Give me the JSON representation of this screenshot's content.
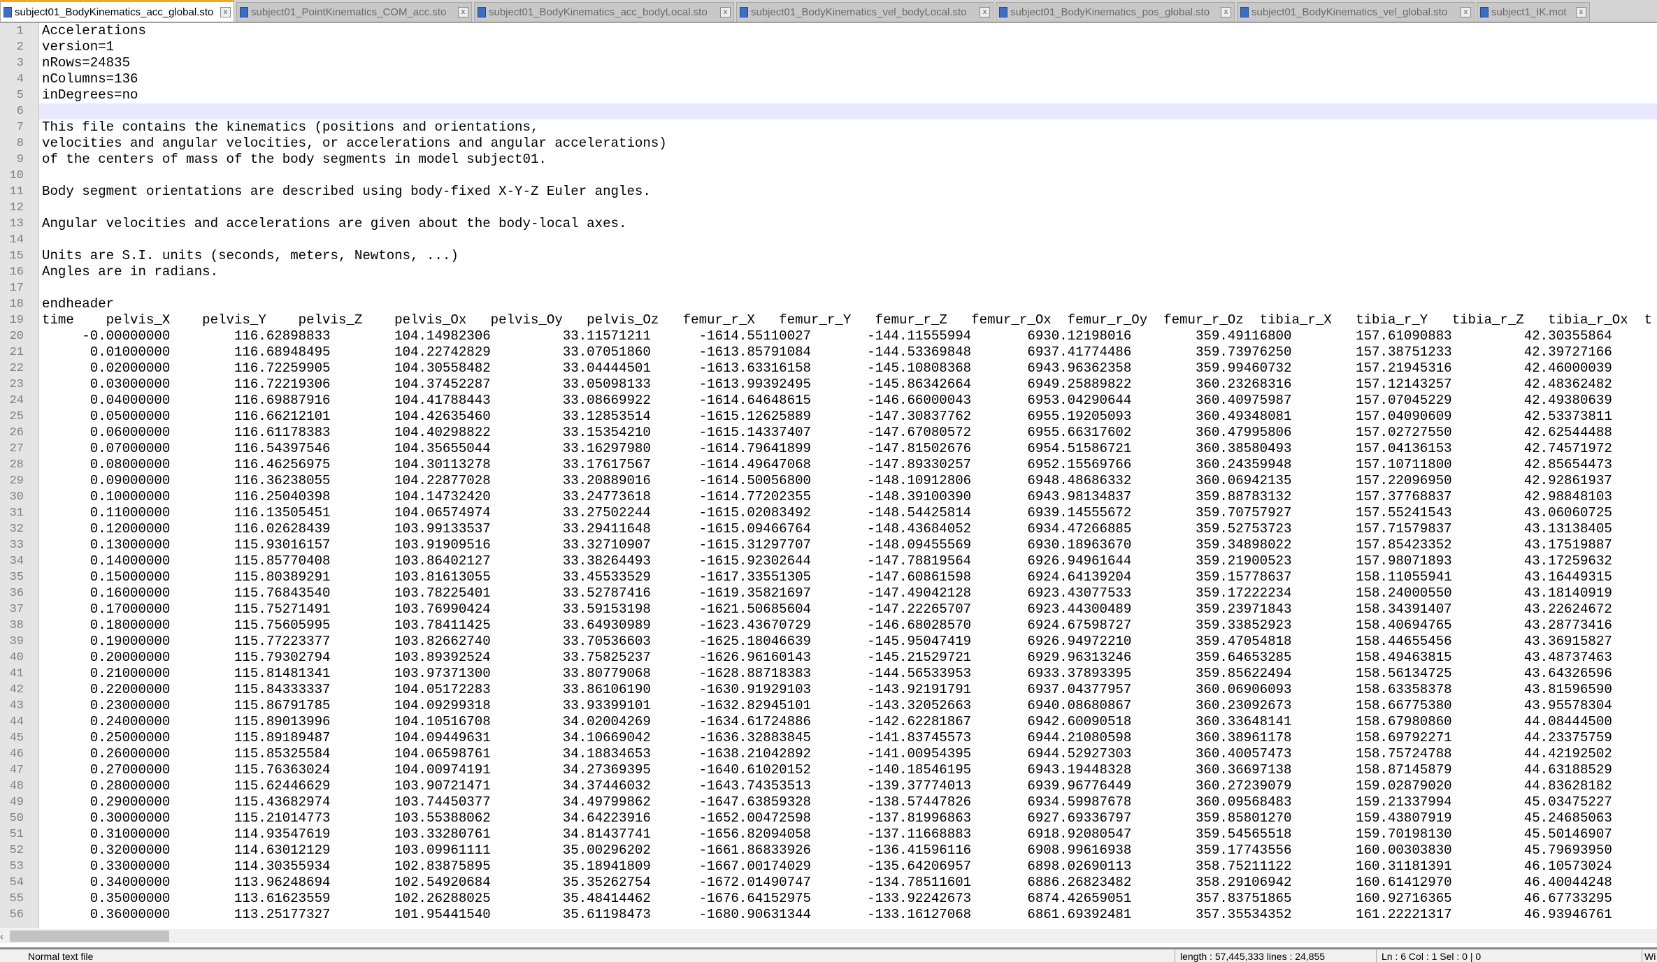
{
  "tabs": [
    {
      "label": "subject01_BodyKinematics_acc_global.sto",
      "active": true
    },
    {
      "label": "subject01_PointKinematics_COM_acc.sto",
      "active": false
    },
    {
      "label": "subject01_BodyKinematics_acc_bodyLocal.sto",
      "active": false
    },
    {
      "label": "subject01_BodyKinematics_vel_bodyLocal.sto",
      "active": false
    },
    {
      "label": "subject01_BodyKinematics_pos_global.sto",
      "active": false
    },
    {
      "label": "subject01_BodyKinematics_vel_global.sto",
      "active": false
    },
    {
      "label": "subject1_IK.mot",
      "active": false
    }
  ],
  "header_lines": [
    "Accelerations",
    "version=1",
    "nRows=24835",
    "nColumns=136",
    "inDegrees=no",
    "",
    "This file contains the kinematics (positions and orientations,",
    "velocities and angular velocities, or accelerations and angular accelerations)",
    "of the centers of mass of the body segments in model subject01.",
    "",
    "Body segment orientations are described using body-fixed X-Y-Z Euler angles.",
    "",
    "Angular velocities and accelerations are given about the body-local axes.",
    "",
    "Units are S.I. units (seconds, meters, Newtons, ...)",
    "Angles are in radians.",
    "",
    "endheader"
  ],
  "current_line": 6,
  "columns": [
    "time",
    "pelvis_X",
    "pelvis_Y",
    "pelvis_Z",
    "pelvis_Ox",
    "pelvis_Oy",
    "pelvis_Oz",
    "femur_r_X",
    "femur_r_Y",
    "femur_r_Z",
    "femur_r_Ox",
    "femur_r_Oy",
    "femur_r_Oz",
    "tibia_r_X",
    "tibia_r_Y",
    "tibia_r_Z",
    "tibia_r_Ox",
    "t"
  ],
  "rows": [
    [
      "-0.00000000",
      "116.62898833",
      "104.14982306",
      "33.11571211",
      "-1614.55110027",
      "-144.11555994",
      "6930.12198016",
      "359.49116800",
      "157.61090883",
      "42.30355864"
    ],
    [
      "0.01000000",
      "116.68948495",
      "104.22742829",
      "33.07051860",
      "-1613.85791084",
      "-144.53369848",
      "6937.41774486",
      "359.73976250",
      "157.38751233",
      "42.39727166"
    ],
    [
      "0.02000000",
      "116.72259905",
      "104.30558482",
      "33.04444501",
      "-1613.63316158",
      "-145.10808368",
      "6943.96362358",
      "359.99460732",
      "157.21945316",
      "42.46000039"
    ],
    [
      "0.03000000",
      "116.72219306",
      "104.37452287",
      "33.05098133",
      "-1613.99392495",
      "-145.86342664",
      "6949.25889822",
      "360.23268316",
      "157.12143257",
      "42.48362482"
    ],
    [
      "0.04000000",
      "116.69887916",
      "104.41788443",
      "33.08669922",
      "-1614.64648615",
      "-146.66000043",
      "6953.04290644",
      "360.40975987",
      "157.07045229",
      "42.49380639"
    ],
    [
      "0.05000000",
      "116.66212101",
      "104.42635460",
      "33.12853514",
      "-1615.12625889",
      "-147.30837762",
      "6955.19205093",
      "360.49348081",
      "157.04090609",
      "42.53373811"
    ],
    [
      "0.06000000",
      "116.61178383",
      "104.40298822",
      "33.15354210",
      "-1615.14337407",
      "-147.67080572",
      "6955.66317602",
      "360.47995806",
      "157.02727550",
      "42.62544488"
    ],
    [
      "0.07000000",
      "116.54397546",
      "104.35655044",
      "33.16297980",
      "-1614.79641899",
      "-147.81502676",
      "6954.51586721",
      "360.38580493",
      "157.04136153",
      "42.74571972"
    ],
    [
      "0.08000000",
      "116.46256975",
      "104.30113278",
      "33.17617567",
      "-1614.49647068",
      "-147.89330257",
      "6952.15569766",
      "360.24359948",
      "157.10711800",
      "42.85654473"
    ],
    [
      "0.09000000",
      "116.36238055",
      "104.22877028",
      "33.20889016",
      "-1614.50056800",
      "-148.10912806",
      "6948.48686332",
      "360.06942135",
      "157.22096950",
      "42.92861937"
    ],
    [
      "0.10000000",
      "116.25040398",
      "104.14732420",
      "33.24773618",
      "-1614.77202355",
      "-148.39100390",
      "6943.98134837",
      "359.88783132",
      "157.37768837",
      "42.98848103"
    ],
    [
      "0.11000000",
      "116.13505451",
      "104.06574974",
      "33.27502244",
      "-1615.02083492",
      "-148.54425814",
      "6939.14555672",
      "359.70757927",
      "157.55241543",
      "43.06060725"
    ],
    [
      "0.12000000",
      "116.02628439",
      "103.99133537",
      "33.29411648",
      "-1615.09466764",
      "-148.43684052",
      "6934.47266885",
      "359.52753723",
      "157.71579837",
      "43.13138405"
    ],
    [
      "0.13000000",
      "115.93016157",
      "103.91909516",
      "33.32710907",
      "-1615.31297707",
      "-148.09455569",
      "6930.18963670",
      "359.34898022",
      "157.85423352",
      "43.17519887"
    ],
    [
      "0.14000000",
      "115.85770408",
      "103.86402127",
      "33.38264493",
      "-1615.92302644",
      "-147.78819564",
      "6926.94961644",
      "359.21900523",
      "157.98071893",
      "43.17259632"
    ],
    [
      "0.15000000",
      "115.80389291",
      "103.81613055",
      "33.45533529",
      "-1617.33551305",
      "-147.60861598",
      "6924.64139204",
      "359.15778637",
      "158.11055941",
      "43.16449315"
    ],
    [
      "0.16000000",
      "115.76843540",
      "103.78225401",
      "33.52787416",
      "-1619.35821697",
      "-147.49042128",
      "6923.43077533",
      "359.17222234",
      "158.24000550",
      "43.18140919"
    ],
    [
      "0.17000000",
      "115.75271491",
      "103.76990424",
      "33.59153198",
      "-1621.50685604",
      "-147.22265707",
      "6923.44300489",
      "359.23971843",
      "158.34391407",
      "43.22624672"
    ],
    [
      "0.18000000",
      "115.75605995",
      "103.78411425",
      "33.64930989",
      "-1623.43670729",
      "-146.68028570",
      "6924.67598727",
      "359.33852923",
      "158.40694765",
      "43.28773416"
    ],
    [
      "0.19000000",
      "115.77223377",
      "103.82662740",
      "33.70536603",
      "-1625.18046639",
      "-145.95047419",
      "6926.94972210",
      "359.47054818",
      "158.44655456",
      "43.36915827"
    ],
    [
      "0.20000000",
      "115.79302794",
      "103.89392524",
      "33.75825237",
      "-1626.96160143",
      "-145.21529721",
      "6929.96313246",
      "359.64653285",
      "158.49463815",
      "43.48737463"
    ],
    [
      "0.21000000",
      "115.81481341",
      "103.97371300",
      "33.80779068",
      "-1628.88718383",
      "-144.56533953",
      "6933.37893395",
      "359.85622494",
      "158.56134725",
      "43.64326596"
    ],
    [
      "0.22000000",
      "115.84333337",
      "104.05172283",
      "33.86106190",
      "-1630.91929103",
      "-143.92191791",
      "6937.04377957",
      "360.06906093",
      "158.63358378",
      "43.81596590"
    ],
    [
      "0.23000000",
      "115.86791785",
      "104.09299318",
      "33.93399101",
      "-1632.82945101",
      "-143.32052663",
      "6940.08680867",
      "360.23092673",
      "158.66775380",
      "43.95578304"
    ],
    [
      "0.24000000",
      "115.89013996",
      "104.10516708",
      "34.02004269",
      "-1634.61724886",
      "-142.62281867",
      "6942.60090518",
      "360.33648141",
      "158.67980860",
      "44.08444500"
    ],
    [
      "0.25000000",
      "115.89189487",
      "104.09449631",
      "34.10669042",
      "-1636.32883845",
      "-141.83745573",
      "6944.21080598",
      "360.38961178",
      "158.69792271",
      "44.23375759"
    ],
    [
      "0.26000000",
      "115.85325584",
      "104.06598761",
      "34.18834653",
      "-1638.21042892",
      "-141.00954395",
      "6944.52927303",
      "360.40057473",
      "158.75724788",
      "44.42192502"
    ],
    [
      "0.27000000",
      "115.76363024",
      "104.00974191",
      "34.27369395",
      "-1640.61020152",
      "-140.18546195",
      "6943.19448328",
      "360.36697138",
      "158.87145879",
      "44.63188529"
    ],
    [
      "0.28000000",
      "115.62446629",
      "103.90721471",
      "34.37446032",
      "-1643.74353513",
      "-139.37774013",
      "6939.96776449",
      "360.27239079",
      "159.02879020",
      "44.83628182"
    ],
    [
      "0.29000000",
      "115.43682974",
      "103.74450377",
      "34.49799862",
      "-1647.63859328",
      "-138.57447826",
      "6934.59987678",
      "360.09568483",
      "159.21337994",
      "45.03475227"
    ],
    [
      "0.30000000",
      "115.21014773",
      "103.55388062",
      "34.64223916",
      "-1652.00472598",
      "-137.81996863",
      "6927.69336797",
      "359.85801270",
      "159.43807919",
      "45.24685063"
    ],
    [
      "0.31000000",
      "114.93547619",
      "103.33280761",
      "34.81437741",
      "-1656.82094058",
      "-137.11668883",
      "6918.92080547",
      "359.54565518",
      "159.70198130",
      "45.50146907"
    ],
    [
      "0.32000000",
      "114.63012129",
      "103.09961111",
      "35.00296202",
      "-1661.86833926",
      "-136.41596116",
      "6908.99616938",
      "359.17743556",
      "160.00303830",
      "45.79693950"
    ],
    [
      "0.33000000",
      "114.30355934",
      "102.83875895",
      "35.18941809",
      "-1667.00174029",
      "-135.64206957",
      "6898.02690113",
      "358.75211122",
      "160.31181391",
      "46.10573024"
    ],
    [
      "0.34000000",
      "113.96248694",
      "102.54920684",
      "35.35262754",
      "-1672.01490747",
      "-134.78511601",
      "6886.26823482",
      "358.29106942",
      "160.61412970",
      "46.40044248"
    ],
    [
      "0.35000000",
      "113.61623559",
      "102.26288025",
      "35.48414462",
      "-1676.64152975",
      "-133.92242673",
      "6874.42659051",
      "357.83751865",
      "160.92716365",
      "46.67733295"
    ],
    [
      "0.36000000",
      "113.25177327",
      "101.95441540",
      "35.61198473",
      "-1680.90631344",
      "-133.16127068",
      "6861.69392481",
      "357.35534352",
      "161.22221317",
      "46.93946761"
    ]
  ],
  "status": {
    "type": "Normal text file",
    "length": "length : 57,445,333    lines : 24,855",
    "position": "Ln : 6    Col : 1    Sel : 0 | 0",
    "right": "Wi"
  },
  "colors": {
    "active_tab_accent": "#f5a623",
    "current_line": "#e8e8ff",
    "gutter": "#e4e4e4"
  }
}
